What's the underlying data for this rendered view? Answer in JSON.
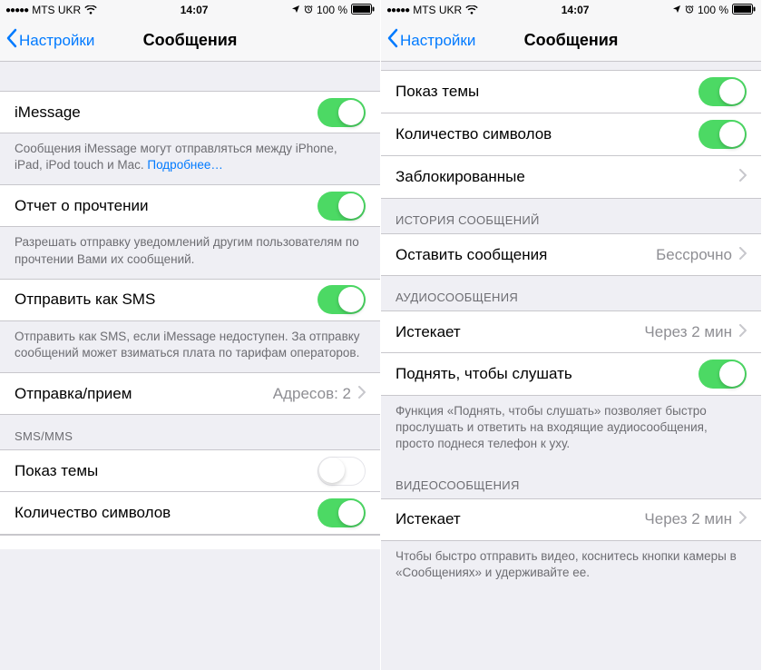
{
  "status": {
    "carrier": "MTS UKR",
    "time": "14:07",
    "battery": "100 %"
  },
  "nav": {
    "back": "Настройки",
    "title": "Сообщения"
  },
  "left": {
    "imessage": {
      "label": "iMessage",
      "on": true
    },
    "imessage_footer": "Сообщения iMessage могут отправляться между iPhone, iPad, iPod touch и Mac.",
    "imessage_more": "Подробнее…",
    "read_receipts": {
      "label": "Отчет о прочтении",
      "on": true
    },
    "read_footer": "Разрешать отправку уведомлений другим пользователям по прочтении Вами их сообщений.",
    "send_sms": {
      "label": "Отправить как SMS",
      "on": true
    },
    "sms_footer": "Отправить как SMS, если iMessage недоступен. За отправку сообщений может взиматься плата по тарифам операторов.",
    "send_receive": {
      "label": "Отправка/прием",
      "value": "Адресов: 2"
    },
    "section_smsmms": "SMS/MMS",
    "show_subject": {
      "label": "Показ темы",
      "on": false
    },
    "char_count": {
      "label": "Количество символов",
      "on": true
    }
  },
  "right": {
    "show_subject": {
      "label": "Показ темы",
      "on": true
    },
    "char_count": {
      "label": "Количество символов",
      "on": true
    },
    "blocked": {
      "label": "Заблокированные"
    },
    "section_history": "ИСТОРИЯ СООБЩЕНИЙ",
    "keep_messages": {
      "label": "Оставить сообщения",
      "value": "Бессрочно"
    },
    "section_audio": "АУДИОСООБЩЕНИЯ",
    "audio_expire": {
      "label": "Истекает",
      "value": "Через 2 мин"
    },
    "raise_listen": {
      "label": "Поднять, чтобы слушать",
      "on": true
    },
    "raise_footer": "Функция «Поднять, чтобы слушать» позволяет быстро прослушать и ответить на входящие аудиосообщения, просто поднеся телефон к уху.",
    "section_video": "ВИДЕОСООБЩЕНИЯ",
    "video_expire": {
      "label": "Истекает",
      "value": "Через 2 мин"
    },
    "video_footer": "Чтобы быстро отправить видео, коснитесь кнопки камеры в «Сообщениях» и удерживайте ее."
  }
}
